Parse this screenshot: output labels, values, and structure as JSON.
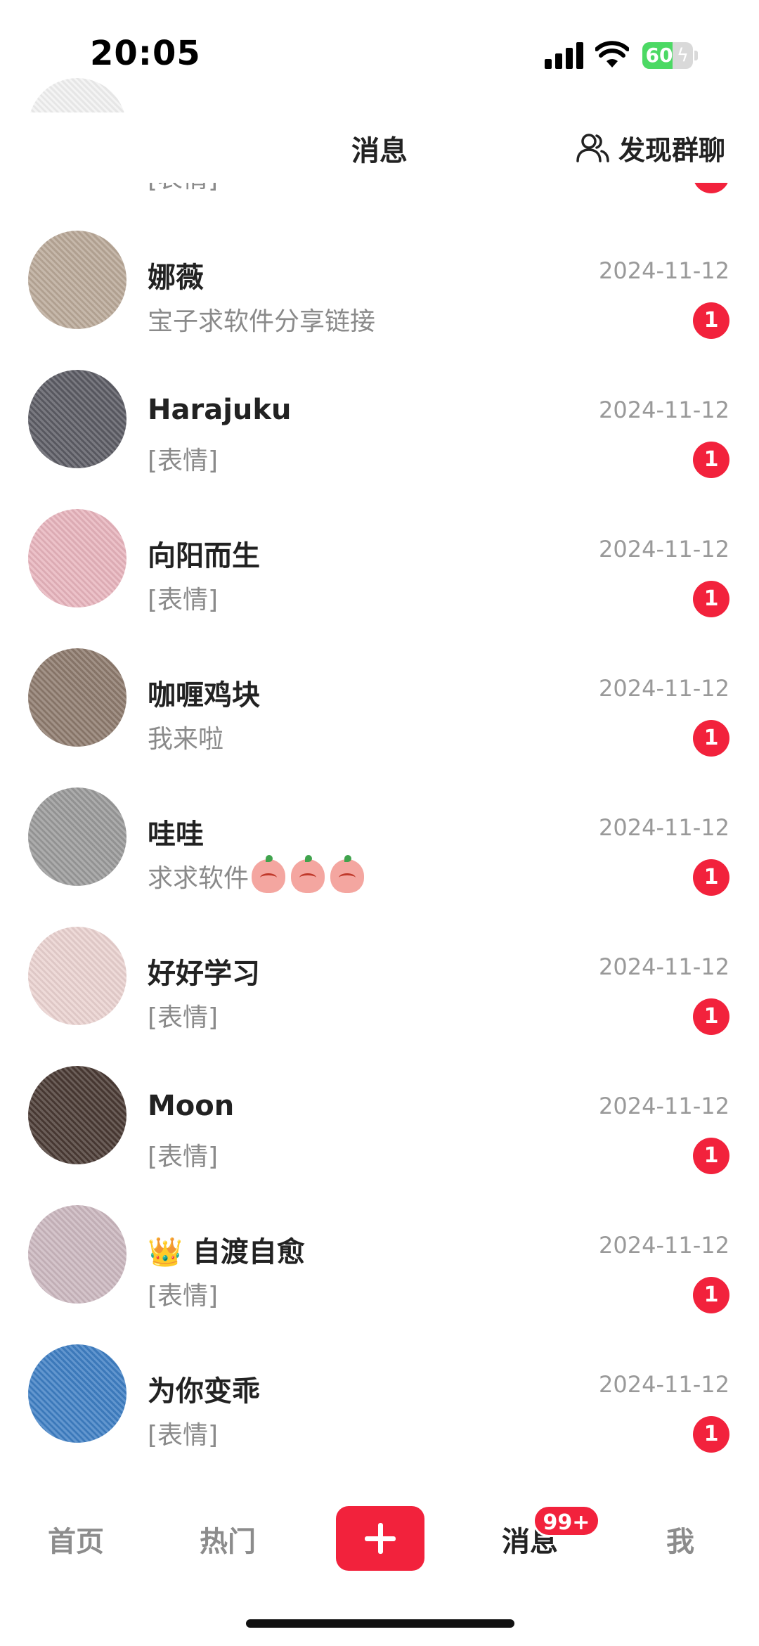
{
  "status_bar": {
    "time": "20:05",
    "battery": "60"
  },
  "header": {
    "title": "消息",
    "discover_label": "发现群聊"
  },
  "partial_row": {
    "preview": "[表情]"
  },
  "messages": [
    {
      "name": "娜薇",
      "preview": "宝子求软件分享链接",
      "date": "2024-11-12",
      "unread": "1",
      "avatar_color": "#b9a898"
    },
    {
      "name": "Harajuku",
      "preview": "[表情]",
      "date": "2024-11-12",
      "unread": "1",
      "avatar_color": "#5c5c64"
    },
    {
      "name": "向阳而生",
      "preview": "[表情]",
      "date": "2024-11-12",
      "unread": "1",
      "avatar_color": "#e8b4bd"
    },
    {
      "name": "咖喱鸡块",
      "preview": "我来啦",
      "date": "2024-11-12",
      "unread": "1",
      "avatar_color": "#8d7a6d"
    },
    {
      "name": "哇哇",
      "preview": "求求软件",
      "date": "2024-11-12",
      "unread": "1",
      "avatar_color": "#9a9a9a",
      "emoji_icon": "peach-emoji-icon"
    },
    {
      "name": "好好学习",
      "preview": "[表情]",
      "date": "2024-11-12",
      "unread": "1",
      "avatar_color": "#ead2d0"
    },
    {
      "name": "Moon",
      "preview": "[表情]",
      "date": "2024-11-12",
      "unread": "1",
      "avatar_color": "#4a3a34"
    },
    {
      "name": "自渡自愈",
      "preview": "[表情]",
      "date": "2024-11-12",
      "unread": "1",
      "avatar_color": "#cbb7bf",
      "name_icon": "crown-icon"
    },
    {
      "name": "为你变乖",
      "preview": "[表情]",
      "date": "2024-11-12",
      "unread": "1",
      "avatar_color": "#3f7fc4"
    }
  ],
  "bottom_nav": {
    "home": "首页",
    "hot": "热门",
    "messages": "消息",
    "messages_badge": "99+",
    "me": "我"
  },
  "colors": {
    "accent": "#f2223c",
    "date_text": "#999999",
    "preview_text": "#8a8a8a"
  }
}
